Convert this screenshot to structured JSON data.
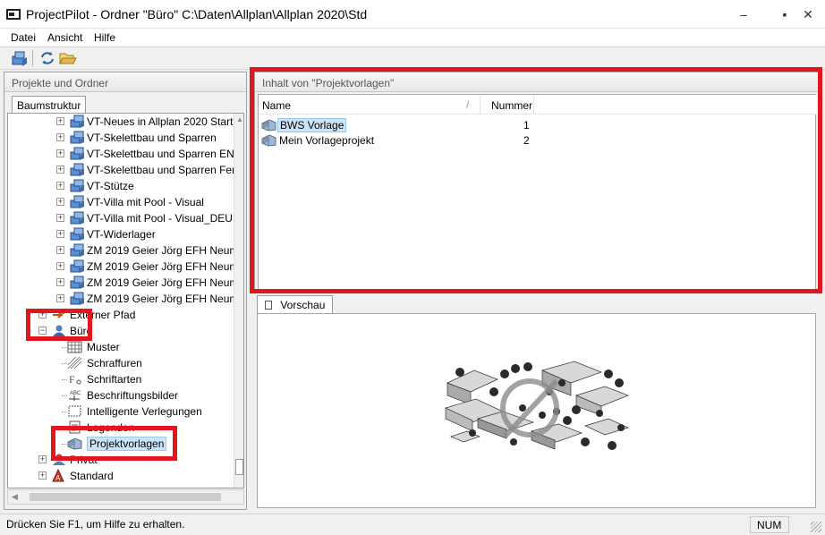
{
  "window": {
    "title": "ProjectPilot - Ordner \"Büro\" C:\\Daten\\Allplan\\Allplan 2020\\Std",
    "minimize": "–",
    "maximize": "▪",
    "close": "✕"
  },
  "menu": {
    "items": [
      {
        "label": "Datei"
      },
      {
        "label": "Ansicht"
      },
      {
        "label": "Hilfe"
      }
    ]
  },
  "left_panel": {
    "header": "Projekte und Ordner",
    "tab": "Baumstruktur",
    "tree": [
      {
        "label": "VT-Neues in Allplan 2020 Start",
        "kind": "project"
      },
      {
        "label": "VT-Skelettbau und Sparren",
        "kind": "project"
      },
      {
        "label": "VT-Skelettbau und Sparren EN",
        "kind": "project"
      },
      {
        "label": "VT-Skelettbau und Sparren Fer",
        "kind": "project"
      },
      {
        "label": "VT-Stütze",
        "kind": "project"
      },
      {
        "label": "VT-Villa mit Pool - Visual",
        "kind": "project"
      },
      {
        "label": "VT-Villa mit Pool - Visual_DEU",
        "kind": "project"
      },
      {
        "label": "VT-Widerlager",
        "kind": "project"
      },
      {
        "label": "ZM 2019 Geier Jörg EFH Neum",
        "kind": "project"
      },
      {
        "label": "ZM 2019 Geier Jörg EFH Neum",
        "kind": "project"
      },
      {
        "label": "ZM 2019 Geier Jörg EFH Neum",
        "kind": "project"
      },
      {
        "label": "ZM 2019 Geier Jörg EFH Neum",
        "kind": "project"
      },
      {
        "label": "Externer Pfad",
        "kind": "external"
      },
      {
        "label": "Büro",
        "kind": "office"
      },
      {
        "label": "Muster",
        "kind": "pattern"
      },
      {
        "label": "Schraffuren",
        "kind": "hatch"
      },
      {
        "label": "Schriftarten",
        "kind": "font"
      },
      {
        "label": "Beschriftungsbilder",
        "kind": "label"
      },
      {
        "label": "Intelligente Verlegungen",
        "kind": "layout"
      },
      {
        "label": "Legenden",
        "kind": "legend"
      },
      {
        "label": "Projektvorlagen",
        "kind": "template"
      },
      {
        "label": "Privat",
        "kind": "private"
      },
      {
        "label": "Standard",
        "kind": "standard"
      }
    ]
  },
  "content": {
    "header": "Inhalt von \"Projektvorlagen\"",
    "columns": {
      "name": "Name",
      "number": "Nummer"
    },
    "rows": [
      {
        "name": "BWS Vorlage",
        "number": "1",
        "selected": true
      },
      {
        "name": "Mein Vorlageprojekt",
        "number": "2",
        "selected": false
      }
    ]
  },
  "preview": {
    "tab": "Vorschau"
  },
  "status": {
    "text": "Drücken Sie F1, um Hilfe zu erhalten.",
    "num": "NUM"
  },
  "colors": {
    "highlight": "#e1161f",
    "selection": "#cce4f7",
    "selection_border": "#99c9ef"
  }
}
